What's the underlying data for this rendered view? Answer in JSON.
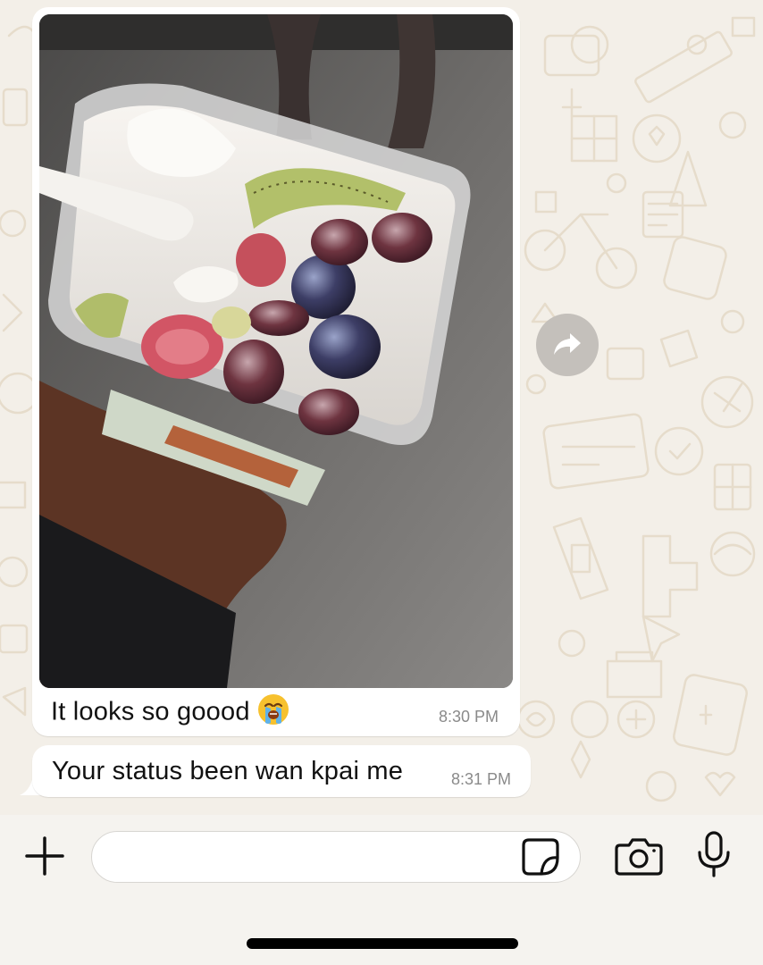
{
  "messages": [
    {
      "type": "image",
      "image_description": "fruit-salad-photo",
      "caption": "It looks so goood",
      "caption_emoji": "loudly-crying-face",
      "time": "8:30 PM"
    },
    {
      "type": "text",
      "text": "Your status been wan kpai me",
      "time": "8:31 PM"
    }
  ],
  "input": {
    "value": "",
    "placeholder": ""
  },
  "icons": {
    "forward": "forward-icon",
    "attach": "plus-icon",
    "sticker": "sticker-icon",
    "camera": "camera-icon",
    "mic": "microphone-icon"
  },
  "colors": {
    "chat_background": "#f3efe8",
    "bubble": "#ffffff",
    "timestamp": "#8a8a8a",
    "forward_button": "#c4c0bb"
  }
}
